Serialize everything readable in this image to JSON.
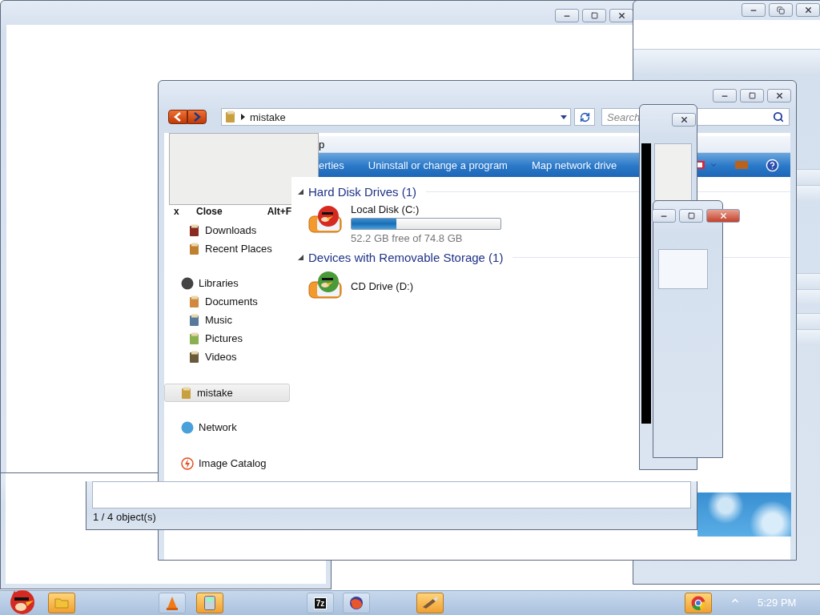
{
  "explorer": {
    "address": "mistake",
    "search": {
      "placeholder": "Search"
    },
    "menu_bar": [
      "p"
    ],
    "command_bar": [
      "erties",
      "Uninstall or change a program",
      "Map network drive"
    ],
    "context_menu": {
      "items": [
        {
          "mark": "x",
          "label": "Close",
          "shortcut": "Alt+F"
        }
      ]
    },
    "nav": [
      {
        "children": [
          {
            "label": "Downloads",
            "kind": "downloads",
            "selected": false
          },
          {
            "label": "Recent Places",
            "kind": "recent",
            "selected": false
          }
        ]
      },
      {
        "label": "Libraries",
        "kind": "libraries",
        "selected": false,
        "children": [
          {
            "label": "Documents",
            "kind": "documents",
            "selected": false
          },
          {
            "label": "Music",
            "kind": "music",
            "selected": false
          },
          {
            "label": "Pictures",
            "kind": "pictures",
            "selected": false
          },
          {
            "label": "Videos",
            "kind": "videos",
            "selected": false
          }
        ]
      },
      {
        "label": "mistake",
        "kind": "computer",
        "selected": true
      },
      {
        "label": "Network",
        "kind": "network",
        "selected": false
      },
      {
        "label": "Image Catalog",
        "kind": "catalog",
        "selected": false
      }
    ],
    "groups": [
      {
        "title": "Hard Disk Drives (1)",
        "items": [
          {
            "name": "Local Disk (C:)",
            "kind": "disk",
            "level": 0.3,
            "free": "52.2 GB free of 74.8 GB"
          }
        ]
      },
      {
        "title": "Devices with Removable Storage (1)",
        "items": [
          {
            "name": "CD Drive (D:)",
            "kind": "cd"
          }
        ]
      }
    ]
  },
  "status_window": {
    "status": "1 / 4 object(s)"
  },
  "taskbar": {
    "apps": [
      {
        "kind": "folder",
        "active": true
      },
      {
        "kind": "cone",
        "active": false
      },
      {
        "kind": "calculator",
        "active": true
      },
      {
        "kind": "archive",
        "label": "7z",
        "active": false
      },
      {
        "kind": "browser",
        "active": false
      },
      {
        "kind": "paint",
        "active": true
      },
      {
        "kind": "chrome",
        "active": true
      }
    ],
    "clock": "5:29 PM"
  }
}
